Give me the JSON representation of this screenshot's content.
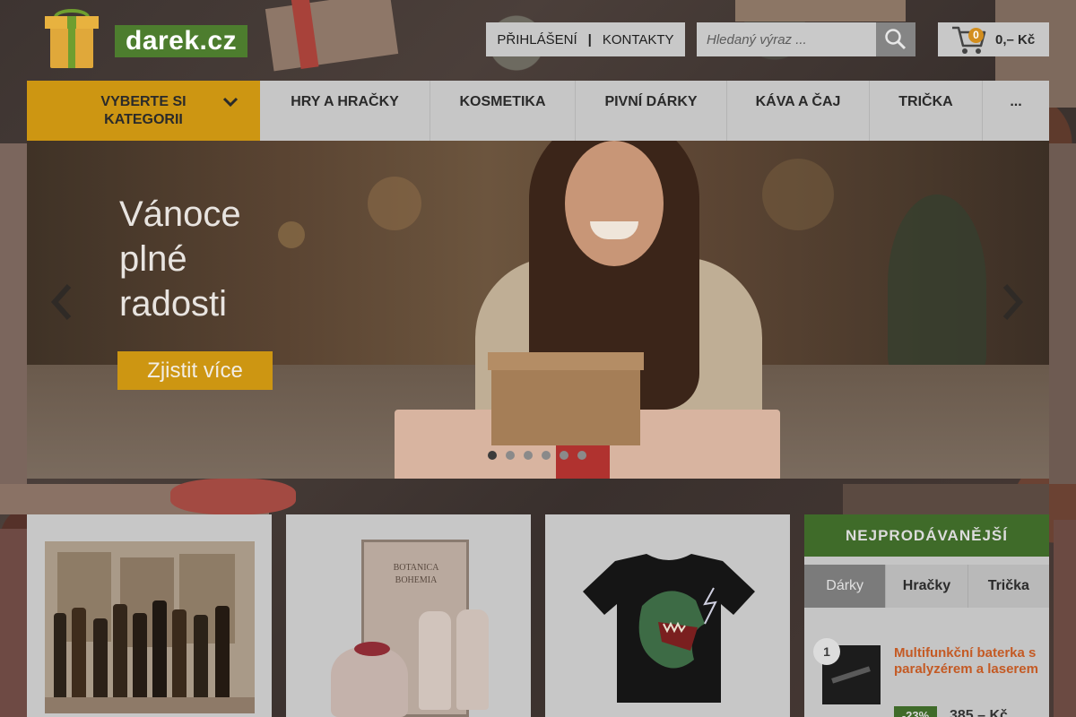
{
  "header": {
    "logo_text": "darek.cz",
    "login_label": "PŘIHLÁŠENÍ",
    "separator": "|",
    "contacts_label": "KONTAKTY",
    "search_placeholder": "Hledaný výraz ...",
    "cart_count": "0",
    "cart_total": "0,– Kč"
  },
  "nav": {
    "category_line1": "VYBERTE SI",
    "category_line2": "KATEGORII",
    "items": [
      {
        "label": "HRY A HRAČKY"
      },
      {
        "label": "KOSMETIKA"
      },
      {
        "label": "PIVNÍ DÁRKY"
      },
      {
        "label": "KÁVA A ČAJ"
      },
      {
        "label": "TRIČKA"
      },
      {
        "label": "..."
      }
    ]
  },
  "banner": {
    "title_line1": "Vánoce",
    "title_line2": "plné",
    "title_line3": "radosti",
    "cta_label": "Zjistit více",
    "slide_count": 6,
    "active_slide": 1
  },
  "products": [
    {
      "name": "beer-gift-set"
    },
    {
      "name": "botanica-bohemia-cosmetics",
      "label_1": "BOTANICA",
      "label_2": "BOHEMIA"
    },
    {
      "name": "dinosaur-tshirt"
    }
  ],
  "bestsellers": {
    "title": "NEJPRODÁVANĚJŠÍ",
    "tabs": [
      {
        "label": "Dárky",
        "active": true
      },
      {
        "label": "Hračky",
        "active": false
      },
      {
        "label": "Trička",
        "active": false
      }
    ],
    "item": {
      "rank": "1",
      "name": "Multifunkční baterka s paralyzérem a laserem",
      "discount": "-23%",
      "price": "385,– Kč"
    }
  },
  "colors": {
    "accent_gold": "#cd9612",
    "brand_green": "#3f6b29",
    "link_orange": "#c45a24"
  }
}
